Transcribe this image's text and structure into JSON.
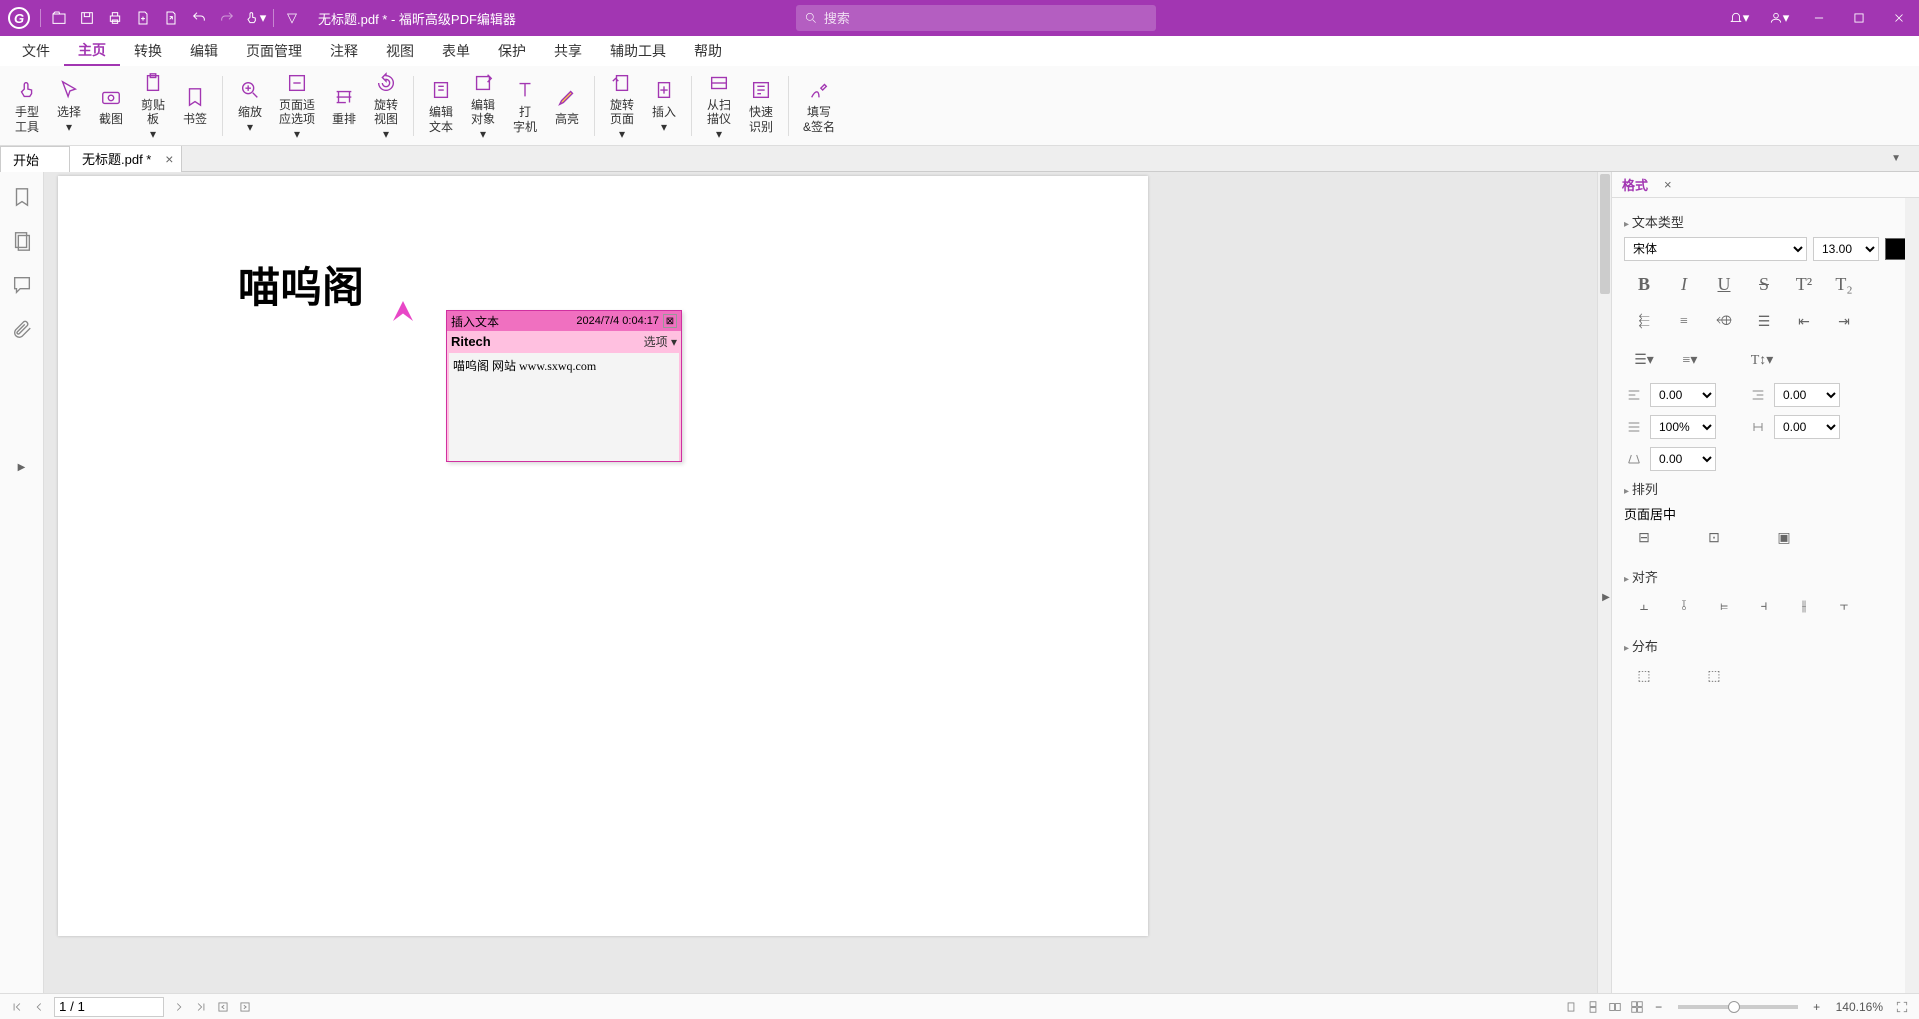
{
  "titlebar": {
    "logo": "G",
    "title": "无标题.pdf * - 福昕高级PDF编辑器",
    "search_placeholder": "搜索"
  },
  "menubar": {
    "items": [
      "文件",
      "主页",
      "转换",
      "编辑",
      "页面管理",
      "注释",
      "视图",
      "表单",
      "保护",
      "共享",
      "辅助工具",
      "帮助"
    ],
    "active_index": 1
  },
  "ribbon": {
    "groups": [
      [
        {
          "label": "手型\n工具",
          "icon": "hand"
        },
        {
          "label": "选择",
          "icon": "cursor",
          "dd": true
        },
        {
          "label": "截图",
          "icon": "camera"
        },
        {
          "label": "剪贴\n板",
          "icon": "clipboard",
          "dd": true
        },
        {
          "label": "书签",
          "icon": "bookmark"
        }
      ],
      [
        {
          "label": "缩放",
          "icon": "zoom",
          "dd": true
        },
        {
          "label": "页面适\n应选项",
          "icon": "fit",
          "dd": true
        },
        {
          "label": "重排",
          "icon": "reflow"
        },
        {
          "label": "旋转\n视图",
          "icon": "rotate",
          "dd": true
        }
      ],
      [
        {
          "label": "编辑\n文本",
          "icon": "edit-text"
        },
        {
          "label": "编辑\n对象",
          "icon": "edit-obj",
          "dd": true
        },
        {
          "label": "打\n字机",
          "icon": "type"
        },
        {
          "label": "高亮",
          "icon": "highlight"
        }
      ],
      [
        {
          "label": "旋转\n页面",
          "icon": "rotate-page",
          "dd": true
        },
        {
          "label": "插入",
          "icon": "insert",
          "dd": true
        }
      ],
      [
        {
          "label": "从扫\n描仪",
          "icon": "scanner",
          "dd": true
        },
        {
          "label": "快速\n识别",
          "icon": "ocr"
        }
      ],
      [
        {
          "label": "填写\n&签名",
          "icon": "sign"
        }
      ]
    ]
  },
  "tabs": {
    "start": "开始",
    "items": [
      {
        "label": "无标题.pdf *",
        "active": true
      }
    ]
  },
  "sidebar": {
    "icons": [
      "bookmark",
      "pages",
      "comments",
      "attach"
    ]
  },
  "document": {
    "big_text": "喵呜阁",
    "note": {
      "header_title": "插入文本",
      "timestamp": "2024/7/4 0:04:17",
      "author": "Ritech",
      "options": "选项 ▾",
      "body": "喵呜阁 网站  www.sxwq.com"
    }
  },
  "format_panel": {
    "tab": "格式",
    "section_text_type": "文本类型",
    "font": "宋体",
    "size": "13.00",
    "buttons": [
      "B",
      "I",
      "U",
      "S",
      "T²",
      "T₂"
    ],
    "align": [
      "left",
      "center",
      "right",
      "justify",
      "indent-l",
      "indent-r"
    ],
    "list": [
      "bullet",
      "number"
    ],
    "spacing1": "0.00",
    "spacing2": "0.00",
    "spacing3": "100%",
    "spacing4": "0.00",
    "spacing5": "0.00",
    "section_arrange": "排列",
    "page_center": "页面居中",
    "section_align": "对齐",
    "section_distribute": "分布"
  },
  "statusbar": {
    "page": "1 / 1",
    "zoom": "140.16%"
  }
}
